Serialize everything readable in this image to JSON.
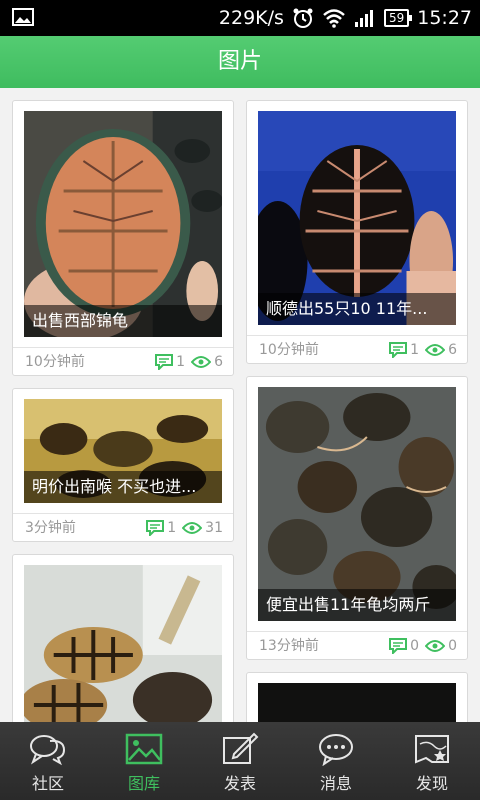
{
  "status_bar": {
    "speed": "229K/s",
    "battery": "59",
    "time": "15:27"
  },
  "header": {
    "title": "图片"
  },
  "cards": [
    {
      "caption": "出售西部锦龟",
      "time": "10分钟前",
      "comments": "1",
      "views": "6"
    },
    {
      "caption": "顺德出55只10 11年...",
      "time": "10分钟前",
      "comments": "1",
      "views": "6"
    },
    {
      "caption": "明价出南喉 不买也进...",
      "time": "3分钟前",
      "comments": "1",
      "views": "31"
    },
    {
      "caption": "便宜出售11年龟均两斤",
      "time": "13分钟前",
      "comments": "0",
      "views": "0"
    }
  ],
  "nav": [
    {
      "label": "社区",
      "icon": "chat-bubbles-icon"
    },
    {
      "label": "图库",
      "icon": "picture-icon"
    },
    {
      "label": "发表",
      "icon": "compose-icon"
    },
    {
      "label": "消息",
      "icon": "message-icon"
    },
    {
      "label": "发现",
      "icon": "map-icon"
    }
  ],
  "colors": {
    "accent": "#3fbf5f",
    "nav_bg": "#2f2f2f"
  }
}
